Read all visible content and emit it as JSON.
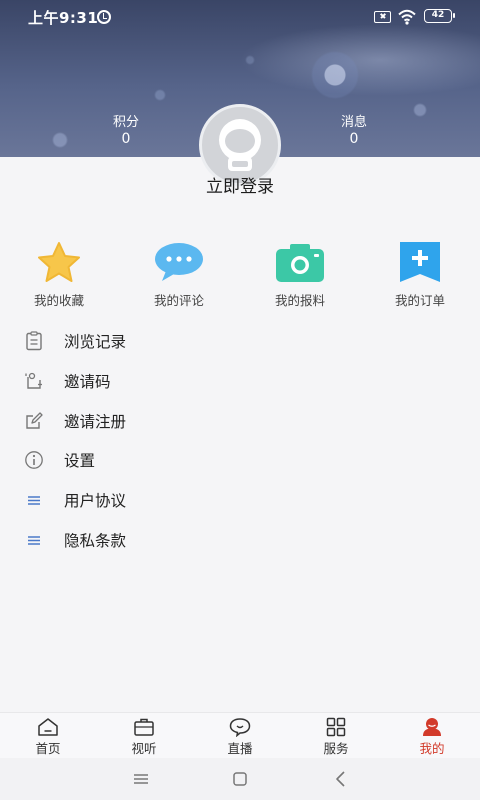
{
  "status_bar": {
    "time": "上午9:31",
    "battery": "42",
    "icons": [
      "alarm-icon",
      "sim-off-icon",
      "wifi-icon",
      "battery-icon"
    ]
  },
  "profile": {
    "points_label": "积分",
    "points_value": "0",
    "messages_label": "消息",
    "messages_value": "0",
    "login_text": "立即登录"
  },
  "quick_actions": [
    {
      "label": "我的收藏",
      "icon": "star-icon"
    },
    {
      "label": "我的评论",
      "icon": "comment-bubble-icon"
    },
    {
      "label": "我的报料",
      "icon": "camera-icon"
    },
    {
      "label": "我的订单",
      "icon": "bookmark-plus-icon"
    }
  ],
  "menu": [
    {
      "label": "浏览记录",
      "icon": "clipboard-icon"
    },
    {
      "label": "邀请码",
      "icon": "invite-code-icon"
    },
    {
      "label": "邀请注册",
      "icon": "edit-icon"
    },
    {
      "label": "设置",
      "icon": "info-icon"
    },
    {
      "label": "用户协议",
      "icon": "lines-icon"
    },
    {
      "label": "隐私条款",
      "icon": "lines-icon"
    }
  ],
  "bottom_nav": [
    {
      "label": "首页",
      "icon": "home-icon"
    },
    {
      "label": "视听",
      "icon": "briefcase-icon"
    },
    {
      "label": "直播",
      "icon": "live-bubble-icon"
    },
    {
      "label": "服务",
      "icon": "grid-icon"
    },
    {
      "label": "我的",
      "icon": "user-icon",
      "active": true
    }
  ],
  "colors": {
    "accent": "#d23a2a",
    "menu_line_icon": "#4a78c9",
    "star": "#f7c64a",
    "comment": "#5bb8f0",
    "camera": "#3cc8a6",
    "bookmark": "#2fa4ec"
  }
}
